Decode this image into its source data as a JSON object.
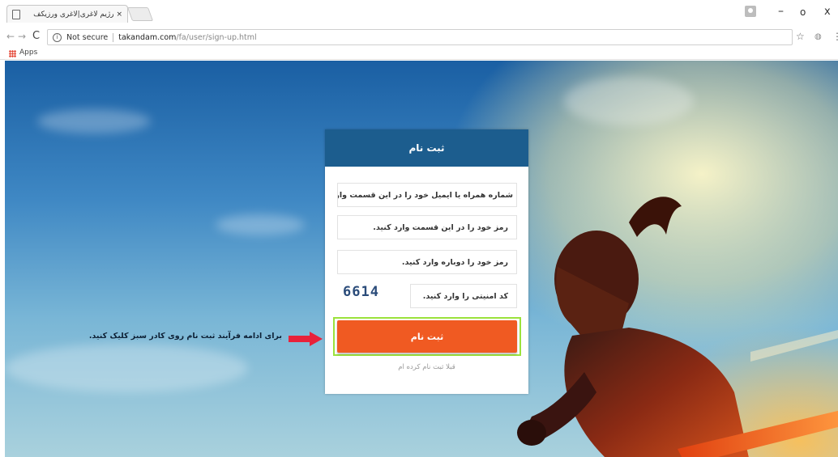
{
  "browser": {
    "tab_title": "× رژیم لاغری|لاغری ورزیکف",
    "tab_close": "×",
    "window_controls": {
      "minimize": "–",
      "maximize": "o",
      "close": "x"
    },
    "nav": {
      "back": "←",
      "forward": "→",
      "reload": "C"
    },
    "address": {
      "security_label": "Not secure",
      "host": "takandam.com",
      "path": "/fa/user/sign-up.html"
    },
    "bookmark_star": "☆",
    "menu": "⋮",
    "bookmarks_bar": {
      "apps_label": "Apps"
    }
  },
  "form": {
    "title": "ثبت نام",
    "mobile_placeholder": "شماره همراه یا ایمیل خود را در این قسمت وارد کنید.",
    "password_placeholder": "رمز خود را در این قسمت وارد کنید.",
    "password_repeat_placeholder": "رمز خود را دوباره وارد کنید.",
    "captcha_placeholder": "کد امنیتی را وارد کنید.",
    "captcha_code": "6614",
    "submit_label": "ثبت نام",
    "login_link": "قبلا ثبت نام کرده ام"
  },
  "annotation": {
    "text": "برای ادامه فرآیند ثبت نام روی کادر سبز کلیک کنید.",
    "arrow_color": "#e8223a",
    "highlight_color": "#9be23c"
  },
  "colors": {
    "header": "#1c5d8e",
    "submit": "#f05a22"
  }
}
